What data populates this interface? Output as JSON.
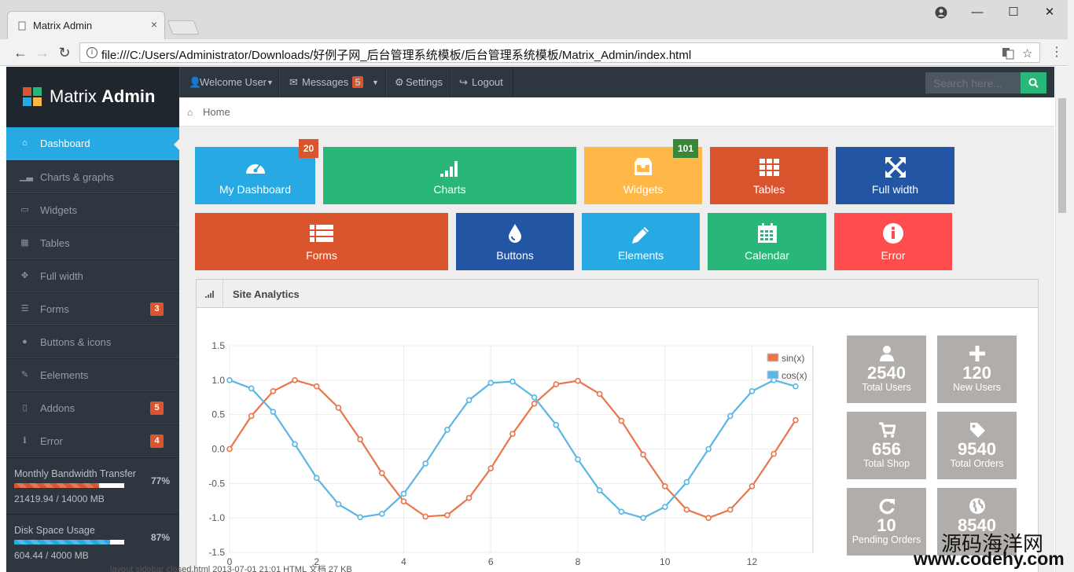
{
  "browser": {
    "tab_title": "Matrix Admin",
    "tab_close": "×",
    "url": "file:///C:/Users/Administrator/Downloads/好例子网_后台管理系统模板/后台管理系统模板/Matrix_Admin/index.html",
    "window_controls": {
      "minimize": "—",
      "maximize": "☐",
      "close": "✕"
    }
  },
  "brand": {
    "name_light": "Matrix",
    "name_bold": "Admin",
    "logo_colors": [
      "#da542e",
      "#28b779",
      "#27a9e3",
      "#ffb848"
    ]
  },
  "topnav": {
    "welcome": "Welcome User",
    "messages": "Messages",
    "messages_badge": "5",
    "settings": "Settings",
    "logout": "Logout",
    "search_placeholder": "Search here..."
  },
  "breadcrumb": {
    "home": "Home"
  },
  "sidebar": {
    "items": [
      {
        "label": "Dashboard",
        "active": true,
        "badge": ""
      },
      {
        "label": "Charts & graphs",
        "badge": ""
      },
      {
        "label": "Widgets",
        "badge": ""
      },
      {
        "label": "Tables",
        "badge": ""
      },
      {
        "label": "Full width",
        "badge": ""
      },
      {
        "label": "Forms",
        "badge": "3"
      },
      {
        "label": "Buttons & icons",
        "badge": ""
      },
      {
        "label": "Eelements",
        "badge": ""
      },
      {
        "label": "Addons",
        "badge": "5"
      },
      {
        "label": "Error",
        "badge": "4"
      }
    ],
    "stats": [
      {
        "label": "Monthly Bandwidth Transfer",
        "value": "21419.94 / 14000 MB",
        "percent": "77%",
        "fraction": 0.77,
        "color": "#da542e"
      },
      {
        "label": "Disk Space Usage",
        "value": "604.44 / 4000 MB",
        "percent": "87%",
        "fraction": 0.87,
        "color": "#27a9e3"
      }
    ]
  },
  "tiles": [
    {
      "label": "My Dashboard",
      "badge": "20",
      "color": "#27a9e3",
      "badge_color": "#da542e",
      "icon": "dashboard-icon"
    },
    {
      "label": "Charts",
      "badge": "",
      "color": "#28b779",
      "icon": "signal-icon"
    },
    {
      "label": "Widgets",
      "badge": "101",
      "color": "#ffb848",
      "badge_color": "#3a873a",
      "icon": "inbox-icon"
    },
    {
      "label": "Tables",
      "badge": "",
      "color": "#da542e",
      "icon": "grid-icon"
    },
    {
      "label": "Full width",
      "badge": "",
      "color": "#2255a4",
      "icon": "fullscreen-icon"
    },
    {
      "label": "Forms",
      "badge": "",
      "color": "#da542e",
      "icon": "list-icon"
    },
    {
      "label": "Buttons",
      "badge": "",
      "color": "#2255a4",
      "icon": "tint-icon"
    },
    {
      "label": "Elements",
      "badge": "",
      "color": "#27a9e3",
      "icon": "pencil-icon"
    },
    {
      "label": "Calendar",
      "badge": "",
      "color": "#28b779",
      "icon": "calendar-icon"
    },
    {
      "label": "Error",
      "badge": "",
      "color": "#ff4c4c",
      "icon": "info-icon"
    }
  ],
  "widget": {
    "title": "Site Analytics"
  },
  "kpis": [
    {
      "num": "2540",
      "label": "Total Users",
      "icon": "user-icon"
    },
    {
      "num": "120",
      "label": "New Users",
      "icon": "plus-icon"
    },
    {
      "num": "656",
      "label": "Total Shop",
      "icon": "cart-icon"
    },
    {
      "num": "9540",
      "label": "Total Orders",
      "icon": "tag-icon"
    },
    {
      "num": "10",
      "label": "Pending Orders",
      "icon": "refresh-icon"
    },
    {
      "num": "8540",
      "label": "",
      "icon": "globe-icon"
    }
  ],
  "chart_data": {
    "type": "line",
    "xlim": [
      0,
      13.4
    ],
    "ylim": [
      -1.5,
      1.5
    ],
    "x_ticks": [
      "0",
      "2",
      "4",
      "6",
      "8",
      "10",
      "12"
    ],
    "y_ticks": [
      "1.5",
      "1.0",
      "0.5",
      "0.0",
      "-0.5",
      "-1.0",
      "-1.5"
    ],
    "grid": true,
    "legend": "top-right",
    "series": [
      {
        "name": "sin(x)",
        "color": "#e9754a",
        "x_step": 0.5,
        "values": [
          0.0,
          0.48,
          0.84,
          1.0,
          0.91,
          0.6,
          0.14,
          -0.35,
          -0.76,
          -0.98,
          -0.96,
          -0.71,
          -0.28,
          0.22,
          0.66,
          0.94,
          0.99,
          0.8,
          0.41,
          -0.08,
          -0.54,
          -0.88,
          -1.0,
          -0.88,
          -0.54,
          -0.07,
          0.42
        ]
      },
      {
        "name": "cos(x)",
        "color": "#5ab6e4",
        "x_step": 0.5,
        "values": [
          1.0,
          0.88,
          0.54,
          0.07,
          -0.42,
          -0.8,
          -0.99,
          -0.94,
          -0.65,
          -0.21,
          0.28,
          0.71,
          0.96,
          0.98,
          0.75,
          0.35,
          -0.15,
          -0.6,
          -0.91,
          -1.0,
          -0.84,
          -0.48,
          0.0,
          0.48,
          0.84,
          1.0,
          0.91
        ]
      }
    ]
  },
  "watermark": {
    "cn": "源码海洋网",
    "url": "www.codehy.com"
  },
  "bottom_text": "layout sidebar closed.html    2013-07-01 21:01    HTML 文档    27 KB"
}
